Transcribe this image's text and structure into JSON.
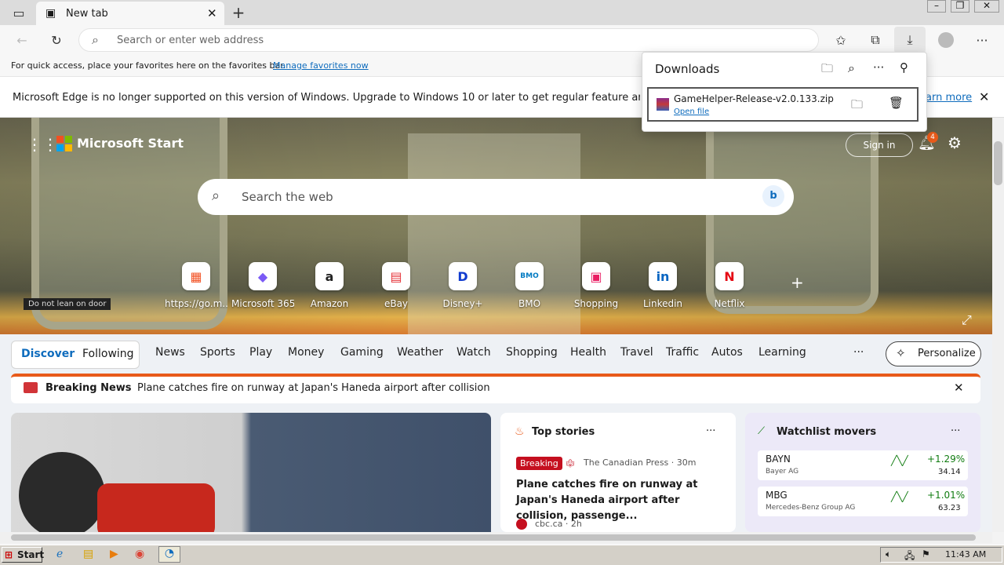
{
  "browser": {
    "tab_title": "New tab",
    "address_placeholder": "Search or enter web address",
    "favorites_hint": "For quick access, place your favorites here on the favorites bar.",
    "favorites_link": "Manage favorites now",
    "infobar_text": "Microsoft Edge is no longer supported on this version of Windows. Upgrade to Windows 10 or later to get regular feature and security u",
    "infobar_link": "arn more"
  },
  "downloads": {
    "title": "Downloads",
    "file_name": "GameHelper-Release-v2.0.133.zip",
    "open_file": "Open file"
  },
  "start": {
    "brand": "Microsoft Start",
    "sign_in": "Sign in",
    "notifications_count": "4",
    "search_placeholder": "Search the web",
    "hero_sign": "Do not lean on door",
    "quick_links": [
      {
        "label": "https://go.m...",
        "glyph": "▦",
        "color": "#f25022"
      },
      {
        "label": "Microsoft 365",
        "glyph": "◆",
        "color": "#7a5af5"
      },
      {
        "label": "Amazon",
        "glyph": "a",
        "color": "#222222"
      },
      {
        "label": "eBay",
        "glyph": "▤",
        "color": "#e53238"
      },
      {
        "label": "Disney+",
        "glyph": "D",
        "color": "#113ccf"
      },
      {
        "label": "BMO",
        "glyph": "BMO",
        "color": "#0079c1"
      },
      {
        "label": "Shopping",
        "glyph": "▣",
        "color": "#e91e63"
      },
      {
        "label": "Linkedin",
        "glyph": "in",
        "color": "#0a66c2"
      },
      {
        "label": "Netflix",
        "glyph": "N",
        "color": "#e50914"
      }
    ]
  },
  "feed_nav": {
    "discover": "Discover",
    "following": "Following",
    "items": [
      "News",
      "Sports",
      "Play",
      "Money",
      "Gaming",
      "Weather",
      "Watch",
      "Shopping",
      "Health",
      "Travel",
      "Traffic",
      "Autos",
      "Learning"
    ],
    "more": "···",
    "personalize": "Personalize"
  },
  "breaking": {
    "label": "Breaking News",
    "headline": "Plane catches fire on runway at Japan's Haneda airport after collision"
  },
  "top_stories": {
    "title": "Top stories",
    "badge": "Breaking",
    "source": "The Canadian Press · 30m",
    "headline": "Plane catches fire on runway at Japan's Haneda airport after collision, passenge...",
    "next_source": "cbc.ca · 2h"
  },
  "watchlist": {
    "title": "Watchlist movers",
    "rows": [
      {
        "ticker": "BAYN",
        "name": "Bayer AG",
        "change": "+1.29%",
        "price": "34.14"
      },
      {
        "ticker": "MBG",
        "name": "Mercedes-Benz Group AG",
        "change": "+1.01%",
        "price": "63.23"
      }
    ]
  },
  "taskbar": {
    "start": "Start",
    "clock": "11:43 AM"
  },
  "colors": {
    "accent": "#0f6cbd",
    "breaking_red": "#c50f1f",
    "positive_green": "#107c10"
  }
}
